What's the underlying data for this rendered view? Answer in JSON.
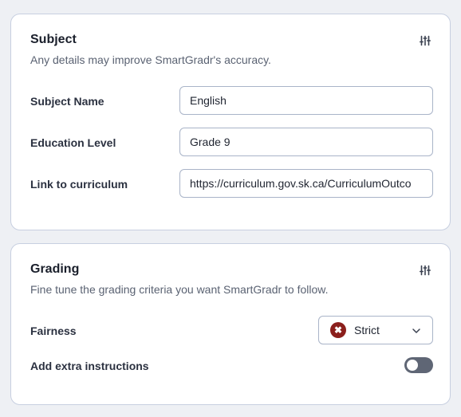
{
  "subject_card": {
    "title": "Subject",
    "description": "Any details may improve SmartGradr's accuracy.",
    "settings_icon": "tune-sliders-icon",
    "fields": [
      {
        "label": "Subject Name",
        "value": "English"
      },
      {
        "label": "Education Level",
        "value": "Grade 9"
      },
      {
        "label": "Link to curriculum",
        "value": "https://curriculum.gov.sk.ca/CurriculumOutco"
      }
    ]
  },
  "grading_card": {
    "title": "Grading",
    "description": "Fine tune the grading criteria you want SmartGradr to follow.",
    "settings_icon": "tune-sliders-icon",
    "fairness": {
      "label": "Fairness",
      "value": "Strict",
      "status_icon": "x-circle-icon",
      "status_color": "#8b1f1c"
    },
    "extra_instructions": {
      "label": "Add extra instructions",
      "enabled": false
    }
  }
}
